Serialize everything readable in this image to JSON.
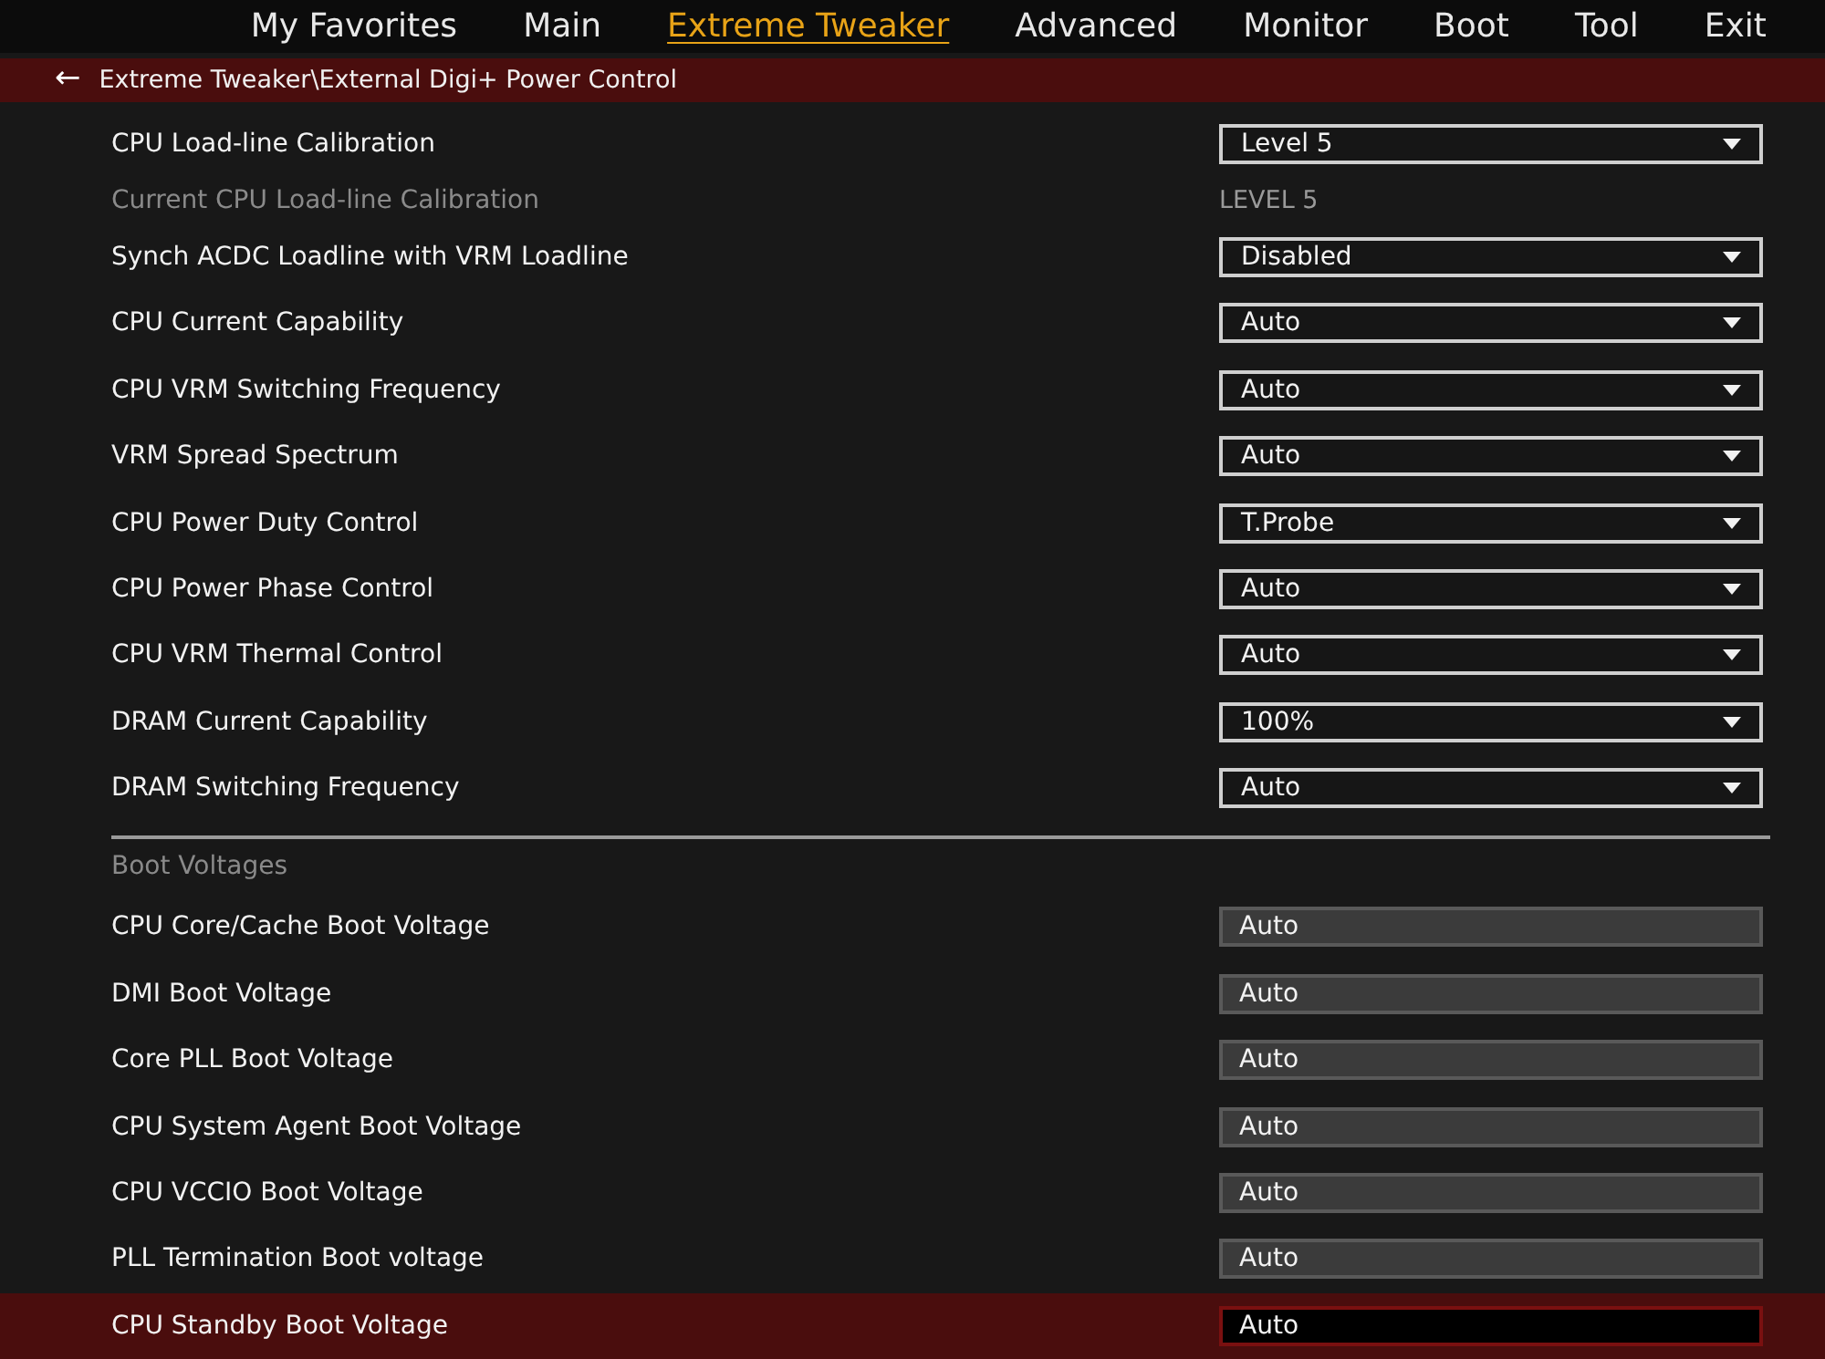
{
  "tabs": [
    {
      "label": "My Favorites",
      "selected": false
    },
    {
      "label": "Main",
      "selected": false
    },
    {
      "label": "Extreme Tweaker",
      "selected": true
    },
    {
      "label": "Advanced",
      "selected": false
    },
    {
      "label": "Monitor",
      "selected": false
    },
    {
      "label": "Boot",
      "selected": false
    },
    {
      "label": "Tool",
      "selected": false
    },
    {
      "label": "Exit",
      "selected": false
    }
  ],
  "breadcrumb": {
    "back_icon": "←",
    "path": "Extreme Tweaker\\External Digi+ Power Control"
  },
  "settings": [
    {
      "kind": "dropdown",
      "label": "CPU Load-line Calibration",
      "value": "Level 5",
      "selected": false
    },
    {
      "kind": "info",
      "label": "Current CPU Load-line Calibration",
      "value": "LEVEL 5"
    },
    {
      "kind": "dropdown",
      "label": "Synch ACDC Loadline with VRM Loadline",
      "value": "Disabled",
      "selected": false
    },
    {
      "kind": "dropdown",
      "label": "CPU Current Capability",
      "value": "Auto",
      "selected": false
    },
    {
      "kind": "dropdown",
      "label": "CPU VRM Switching Frequency",
      "value": "Auto",
      "selected": false
    },
    {
      "kind": "dropdown",
      "label": "VRM Spread Spectrum",
      "value": "Auto",
      "selected": false
    },
    {
      "kind": "dropdown",
      "label": "CPU Power Duty Control",
      "value": "T.Probe",
      "selected": false
    },
    {
      "kind": "dropdown",
      "label": "CPU Power Phase Control",
      "value": "Auto",
      "selected": false
    },
    {
      "kind": "dropdown",
      "label": "CPU VRM Thermal Control",
      "value": "Auto",
      "selected": false
    },
    {
      "kind": "dropdown",
      "label": "DRAM Current Capability",
      "value": "100%",
      "selected": false
    },
    {
      "kind": "dropdown",
      "label": "DRAM Switching Frequency",
      "value": "Auto",
      "selected": false
    },
    {
      "kind": "section",
      "label": "Boot Voltages"
    },
    {
      "kind": "field",
      "label": "CPU Core/Cache Boot Voltage",
      "value": "Auto",
      "selected": false
    },
    {
      "kind": "field",
      "label": "DMI Boot Voltage",
      "value": "Auto",
      "selected": false
    },
    {
      "kind": "field",
      "label": "Core PLL Boot Voltage",
      "value": "Auto",
      "selected": false
    },
    {
      "kind": "field",
      "label": "CPU System Agent Boot Voltage",
      "value": "Auto",
      "selected": false
    },
    {
      "kind": "field",
      "label": "CPU VCCIO Boot Voltage",
      "value": "Auto",
      "selected": false
    },
    {
      "kind": "field",
      "label": "PLL Termination Boot voltage",
      "value": "Auto",
      "selected": false
    },
    {
      "kind": "field",
      "label": "CPU Standby Boot Voltage",
      "value": "Auto",
      "selected": true
    }
  ]
}
